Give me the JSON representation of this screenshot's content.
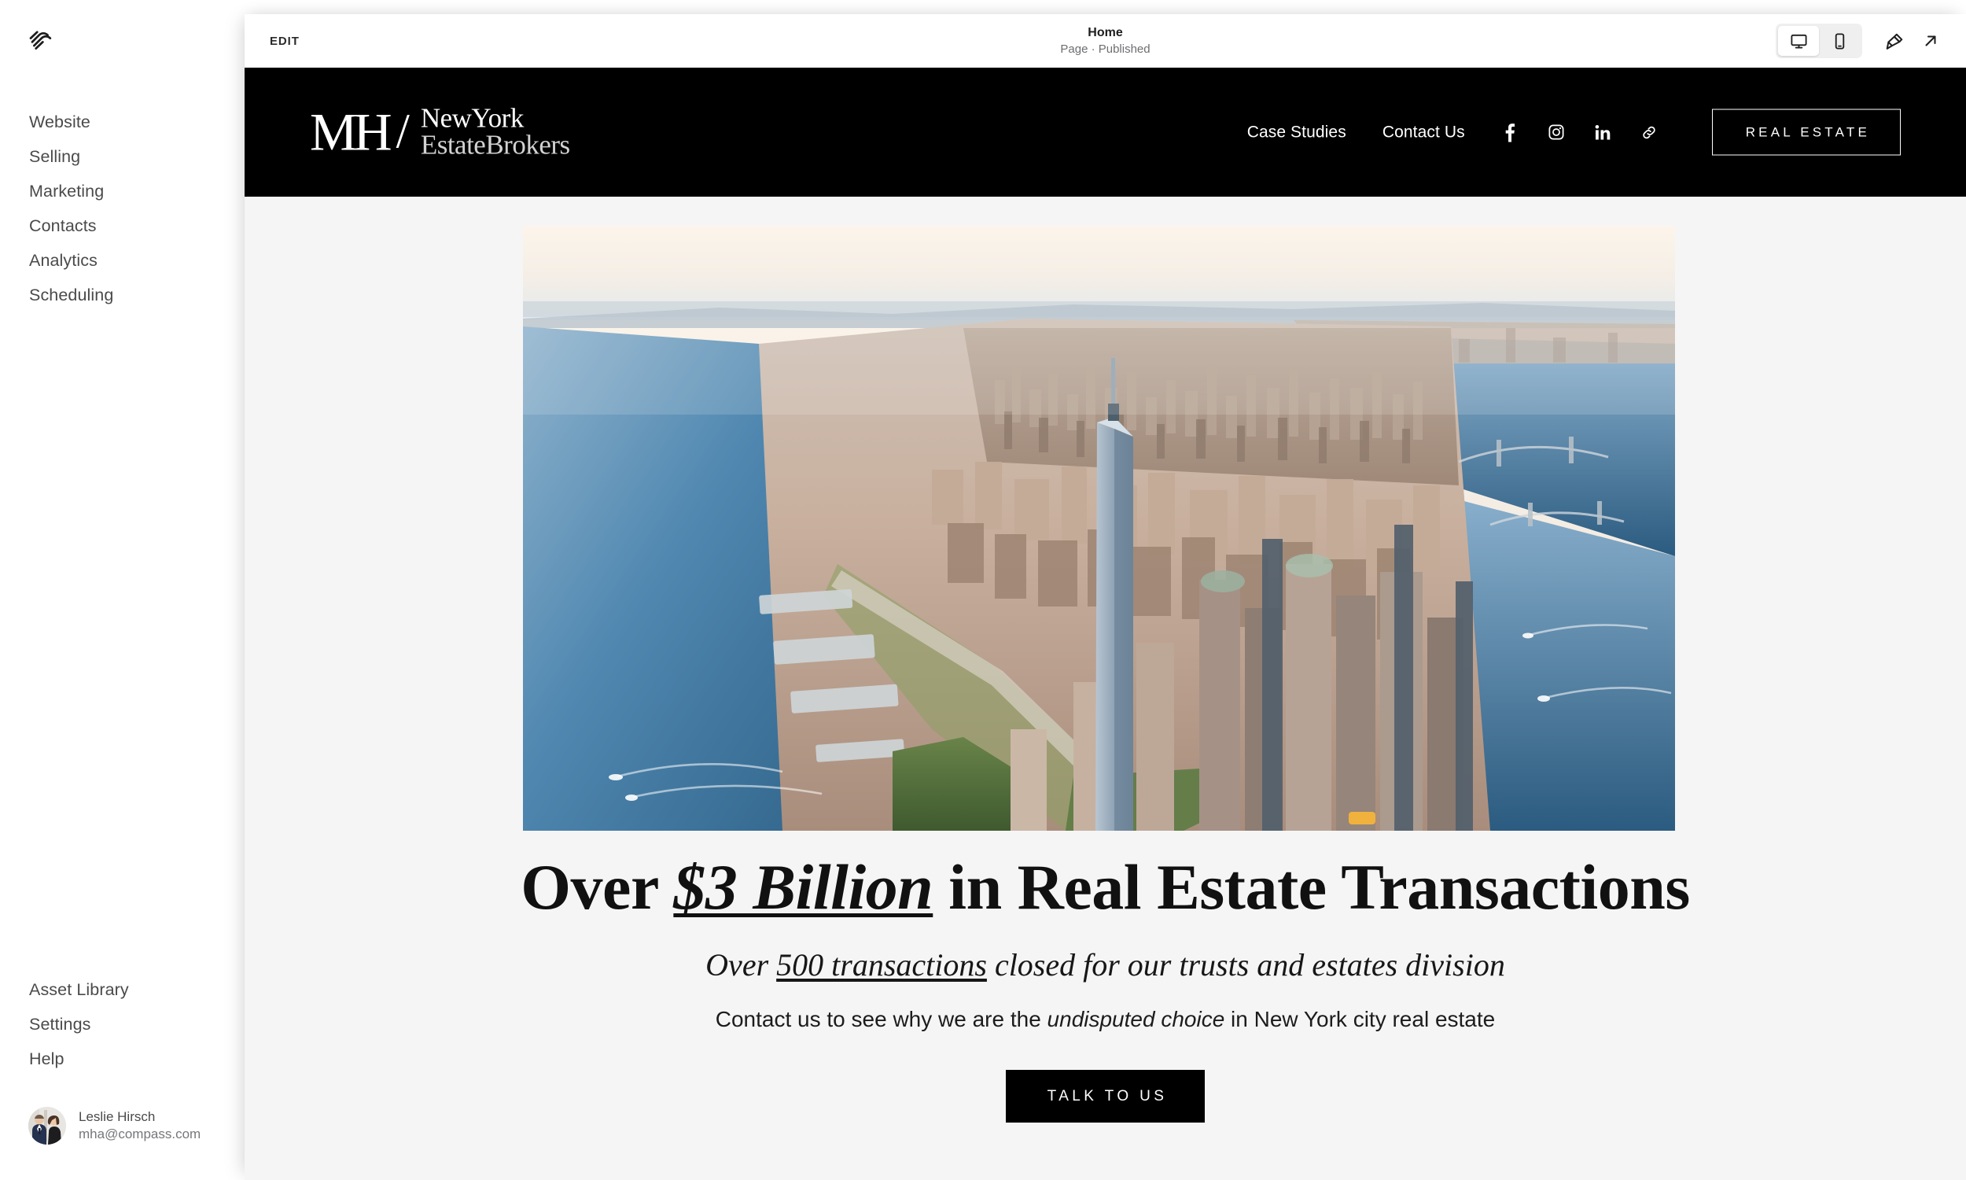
{
  "sidebar": {
    "logo_icon": "squarespace-logo-icon",
    "primary_items": [
      {
        "label": "Website"
      },
      {
        "label": "Selling"
      },
      {
        "label": "Marketing"
      },
      {
        "label": "Contacts"
      },
      {
        "label": "Analytics"
      },
      {
        "label": "Scheduling"
      }
    ],
    "secondary_items": [
      {
        "label": "Asset Library"
      },
      {
        "label": "Settings"
      },
      {
        "label": "Help"
      }
    ],
    "account": {
      "name": "Leslie Hirsch",
      "email": "mha@compass.com",
      "avatar_icon": "user-avatar-photo"
    }
  },
  "toolbar": {
    "edit_label": "EDIT",
    "page_title": "Home",
    "page_status": "Page · Published",
    "device_desktop_icon": "desktop-monitor-icon",
    "device_mobile_icon": "mobile-phone-icon",
    "device_selected": "desktop",
    "style_icon": "paintbrush-icon",
    "open_icon": "arrow-up-right-icon"
  },
  "site": {
    "brand": {
      "mark": "MH",
      "slash": "/",
      "line1": "NewYork",
      "line2": "EstateBrokers"
    },
    "nav_links": [
      {
        "label": "Case Studies"
      },
      {
        "label": "Contact Us"
      }
    ],
    "social": [
      {
        "icon": "facebook-icon"
      },
      {
        "icon": "instagram-icon"
      },
      {
        "icon": "linkedin-icon"
      },
      {
        "icon": "link-chain-icon"
      }
    ],
    "header_cta": "REAL ESTATE",
    "hero": {
      "image_alt": "aerial-view-of-lower-manhattan-new-york-city",
      "headline_pre": "Over ",
      "headline_em": "$3 Billion",
      "headline_post": " in Real Estate Transactions",
      "subhead_pre": "Over ",
      "subhead_u": "500 transactions",
      "subhead_post": " closed for our trusts and estates division",
      "tagline_pre": "Contact us to see why we are the ",
      "tagline_i": "undisputed choice",
      "tagline_post": " in New York city real estate",
      "cta": "TALK TO US"
    }
  },
  "colors": {
    "canvas_bg": "#f5f5f5",
    "header_bg": "#000000",
    "accent_text": "#ffffff",
    "sidebar_text": "#4a4a4a"
  }
}
